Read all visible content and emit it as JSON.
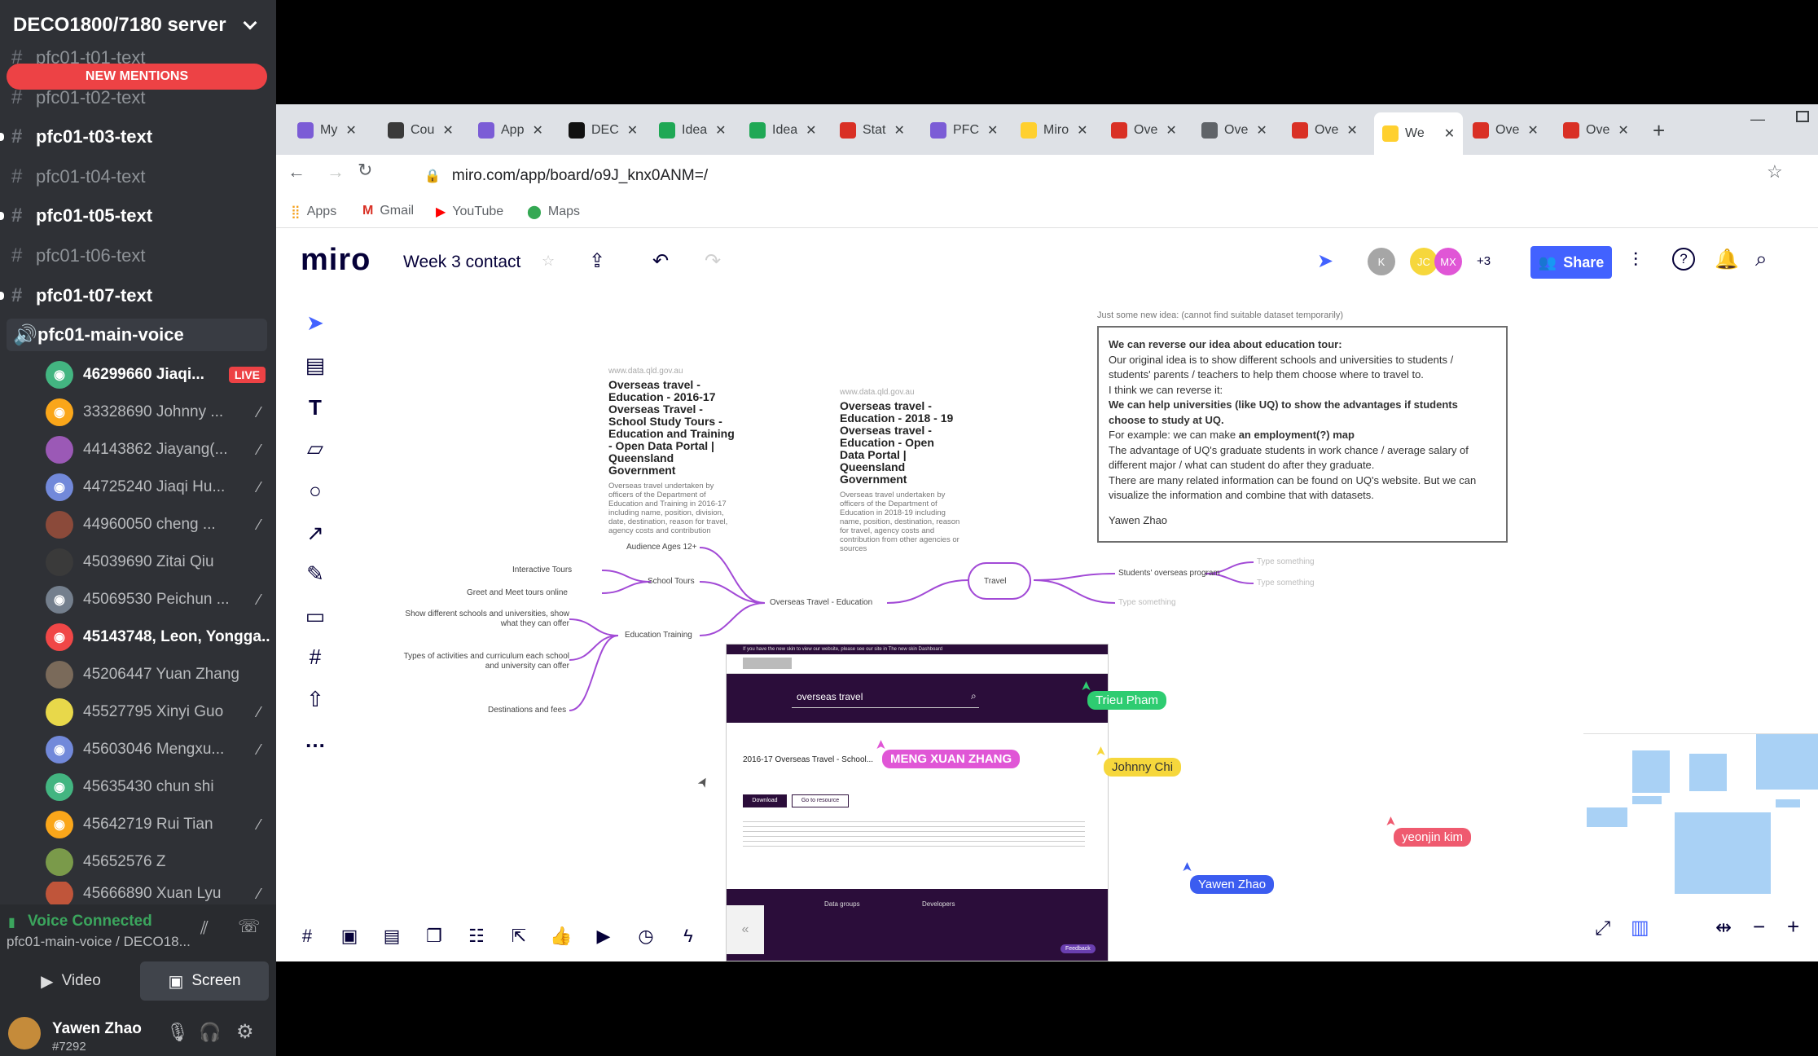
{
  "discord": {
    "server_name": "DECO1800/7180 server",
    "new_mentions": "NEW MENTIONS",
    "channels": [
      {
        "name": "pfc01-t01-text"
      },
      {
        "name": "pfc01-t02-text"
      },
      {
        "name": "pfc01-t03-text"
      },
      {
        "name": "pfc01-t04-text"
      },
      {
        "name": "pfc01-t05-text"
      },
      {
        "name": "pfc01-t06-text"
      },
      {
        "name": "pfc01-t07-text"
      },
      {
        "name": "pfc01-main-voice"
      }
    ],
    "voice_users": [
      {
        "name": "46299660 Jiaqi...",
        "badge": "LIVE",
        "color": "#43b581"
      },
      {
        "name": "33328690 Johnny ...",
        "color": "#faa61a"
      },
      {
        "name": "44143862 Jiayang(...",
        "color": "#9b59b6"
      },
      {
        "name": "44725240 Jiaqi Hu...",
        "color": "#7289da"
      },
      {
        "name": "44960050 cheng ...",
        "color": "#8b4a3a"
      },
      {
        "name": "45039690 Zitai Qiu",
        "color": "#3a3a3a"
      },
      {
        "name": "45069530 Peichun ...",
        "color": "#747f8d"
      },
      {
        "name": "45143748, Leon, Yongga...",
        "color": "#f04747"
      },
      {
        "name": "45206447 Yuan Zhang",
        "color": "#7a6a5a"
      },
      {
        "name": "45527795 Xinyi Guo",
        "color": "#e8d84a"
      },
      {
        "name": "45603046 Mengxu...",
        "color": "#7289da"
      },
      {
        "name": "45635430 chun shi",
        "color": "#43b581"
      },
      {
        "name": "45642719 Rui Tian",
        "color": "#faa61a"
      },
      {
        "name": "45652576 Z",
        "color": "#7a9a4a"
      },
      {
        "name": "45666890 Xuan Lyu",
        "color": "#c0553a"
      }
    ],
    "voice_status": "Voice Connected",
    "voice_channel": "pfc01-main-voice / DECO18...",
    "video_label": "Video",
    "screen_label": "Screen",
    "username": "Yawen Zhao",
    "discriminator": "#7292"
  },
  "browser": {
    "tabs": [
      {
        "label": "My",
        "color": "#7b5cd6"
      },
      {
        "label": "Cou",
        "color": "#3a3a3a"
      },
      {
        "label": "App",
        "color": "#7b5cd6"
      },
      {
        "label": "DEC",
        "color": "#111111"
      },
      {
        "label": "Idea",
        "color": "#1fa855"
      },
      {
        "label": "Idea",
        "color": "#1fa855"
      },
      {
        "label": "Stat",
        "color": "#d93025"
      },
      {
        "label": "PFC",
        "color": "#7b5cd6"
      },
      {
        "label": "Miro",
        "color": "#ffd02f"
      },
      {
        "label": "Ove",
        "color": "#d93025"
      },
      {
        "label": "Ove",
        "color": "#5f6368"
      },
      {
        "label": "Ove",
        "color": "#d93025"
      },
      {
        "label": "We",
        "color": "#ffd02f"
      },
      {
        "label": "Ove",
        "color": "#d93025"
      },
      {
        "label": "Ove",
        "color": "#d93025"
      }
    ],
    "new_tab": "+",
    "url": "miro.com/app/board/o9J_knx0ANM=/",
    "bookmarks": [
      "Apps",
      "Gmail",
      "YouTube",
      "Maps"
    ]
  },
  "miro": {
    "logo": "miro",
    "board_title": "Week 3 contact",
    "share_label": "Share",
    "collab_more": "+3",
    "collab_initials": [
      "K",
      "JC",
      "MX"
    ],
    "note": {
      "caption": "Just some new idea: (cannot find suitable dataset temporarily)",
      "heading": "We can reverse our idea about education tour:",
      "p1": "Our original idea is to show different schools and universities to students / students' parents / teachers to help them choose where to travel to.",
      "p2": "I think we can reverse it:",
      "p3": "We can help universities (like UQ) to show the advantages if students choose to study at UQ.",
      "p4a": "For example: we can make ",
      "p4b": "an employment(?) map",
      "p5": "The advantage of UQ's graduate students in work chance / average salary of different major / what can student do after they graduate.",
      "p6": "There are many related information can be found on UQ's website. But we can visualize the information and combine that with datasets.",
      "signature": "Yawen Zhao"
    },
    "card1": {
      "source": "www.data.qld.gov.au",
      "title": "Overseas travel - Education - 2016-17 Overseas Travel - School Study Tours - Education and Training - Open Data Portal | Queensland Government",
      "desc": "Overseas travel undertaken by officers of the Department of Education and Training in 2016-17 including name, position, division, date, destination, reason for travel, agency costs and contribution"
    },
    "card2": {
      "source": "www.data.qld.gov.au",
      "title": "Overseas travel - Education - 2018 - 19 Overseas travel - Education - Open Data Portal | Queensland Government",
      "desc": "Overseas travel undertaken by officers of the Department of Education in 2018-19 including name, position, destination, reason for travel, agency costs and contribution from other agencies or sources"
    },
    "mindmap": {
      "center": "Overseas Travel - Education",
      "travel": "Travel",
      "audience": "Audience Ages 12+",
      "school_tours": "School Tours",
      "interactive": "Interactive Tours",
      "greet": "Greet and Meet tours online",
      "edu_training": "Education Training",
      "show_diff": "Show different schools and universities, show what they can offer",
      "types": "Types of activities and curriculum each school and university can offer",
      "destinations": "Destinations and fees",
      "students_program": "Students' overseas program",
      "type1": "Type something",
      "type2": "Type something",
      "type3": "Type something"
    },
    "embed": {
      "banner": "If you have the new skin to view our website, please see our site in The new skin Dashboard",
      "search": "overseas travel",
      "page_title": "2016-17 Overseas Travel - School...",
      "download_btn": "Download",
      "go_btn": "Go to resource",
      "footer_col1": "Data groups",
      "footer_col2": "Developers",
      "feedback": "Feedback"
    },
    "cursors": [
      {
        "name": "Trieu Pham",
        "color": "#2ecc71"
      },
      {
        "name": "MENG XUAN ZHANG",
        "color": "#e056d6"
      },
      {
        "name": "Johnny Chi",
        "color": "#f6d73c"
      },
      {
        "name": "yeonjin kim",
        "color": "#ef5a6f"
      },
      {
        "name": "Yawen Zhao",
        "color": "#3b5cf0"
      }
    ]
  }
}
